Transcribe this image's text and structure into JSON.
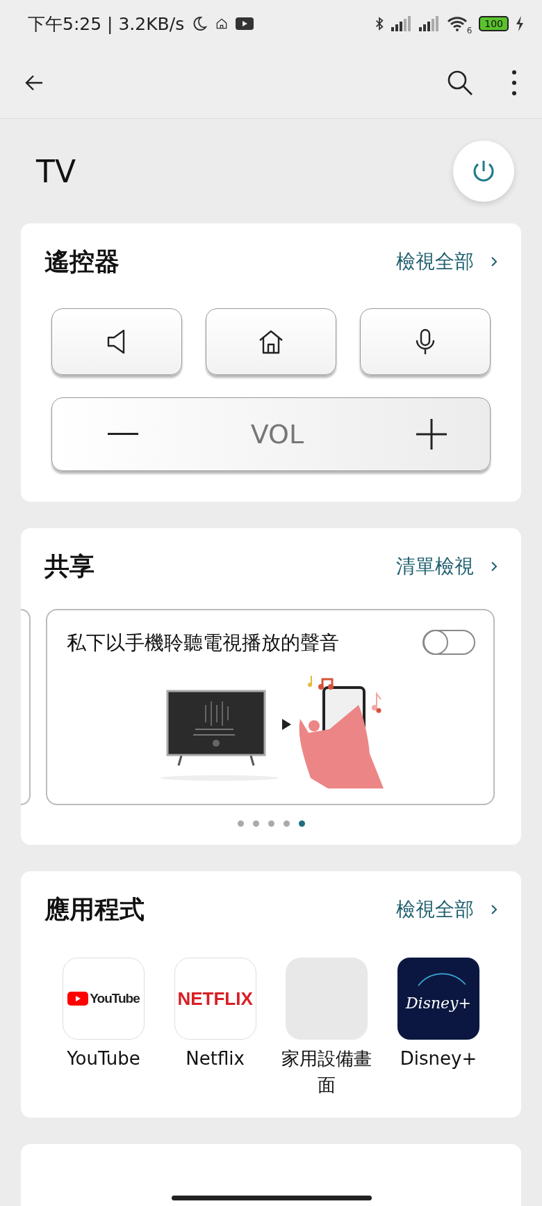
{
  "status_bar": {
    "time_speed": "下午5:25 | 3.2KB/s",
    "wifi_band": "6",
    "battery": "100"
  },
  "page": {
    "title": "TV"
  },
  "remote": {
    "title": "遙控器",
    "link": "檢視全部",
    "vol_label": "VOL"
  },
  "share": {
    "title": "共享",
    "link": "清單檢視",
    "card": {
      "text": "私下以手機聆聽電視播放的聲音",
      "on": false
    },
    "dots": [
      {
        "selected": false
      },
      {
        "selected": false
      },
      {
        "selected": false
      },
      {
        "selected": false
      },
      {
        "selected": true
      }
    ]
  },
  "apps": {
    "title": "應用程式",
    "link": "檢視全部",
    "items": [
      {
        "kind": "youtube",
        "logo": "YouTube",
        "label": "YouTube"
      },
      {
        "kind": "netflix",
        "logo": "NETFLIX",
        "label": "Netflix"
      },
      {
        "kind": "blank",
        "label": "家用設備畫面"
      },
      {
        "kind": "disney",
        "logo": "Disney+",
        "label": "Disney+"
      }
    ]
  }
}
